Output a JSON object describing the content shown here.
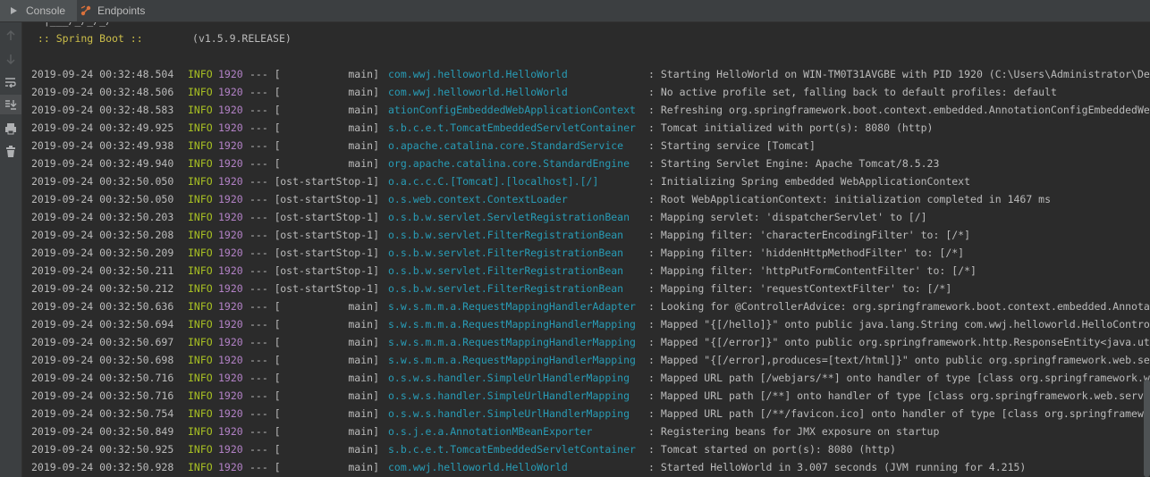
{
  "tabs": [
    {
      "label": "Console",
      "icon": "console-icon",
      "active": true
    },
    {
      "label": "Endpoints",
      "icon": "endpoints-icon",
      "active": false
    }
  ],
  "toolbar": [
    {
      "icon": "arrow-up-icon"
    },
    {
      "icon": "arrow-down-icon"
    },
    {
      "icon": "soft-wrap-icon"
    },
    {
      "icon": "scroll-to-end-icon"
    },
    {
      "icon": "print-icon"
    },
    {
      "icon": "trash-icon"
    }
  ],
  "banner": {
    "art_tail": "  |___/_/_/_/",
    "spring_label": " :: Spring Boot :: ",
    "version": "       (v1.5.9.RELEASE)"
  },
  "colors": {
    "background": "#2b2b2b",
    "info": "#a8c023",
    "pid": "#b382c7",
    "logger": "#289cb6",
    "text": "#bbbbbb"
  },
  "log_rows": [
    {
      "time": "2019-09-24 00:32:48.504",
      "level": "INFO",
      "pid": "1920",
      "sep": "--- [",
      "thread": "main]",
      "logger": "com.wwj.helloworld.HelloWorld",
      "message": ": Starting HelloWorld on WIN-TM0T31AVGBE with PID 1920 (C:\\Users\\Administrator\\De"
    },
    {
      "time": "2019-09-24 00:32:48.506",
      "level": "INFO",
      "pid": "1920",
      "sep": "--- [",
      "thread": "main]",
      "logger": "com.wwj.helloworld.HelloWorld",
      "message": ": No active profile set, falling back to default profiles: default"
    },
    {
      "time": "2019-09-24 00:32:48.583",
      "level": "INFO",
      "pid": "1920",
      "sep": "--- [",
      "thread": "main]",
      "logger": "ationConfigEmbeddedWebApplicationContext",
      "message": ": Refreshing org.springframework.boot.context.embedded.AnnotationConfigEmbeddedWe"
    },
    {
      "time": "2019-09-24 00:32:49.925",
      "level": "INFO",
      "pid": "1920",
      "sep": "--- [",
      "thread": "main]",
      "logger": "s.b.c.e.t.TomcatEmbeddedServletContainer",
      "message": ": Tomcat initialized with port(s): 8080 (http)"
    },
    {
      "time": "2019-09-24 00:32:49.938",
      "level": "INFO",
      "pid": "1920",
      "sep": "--- [",
      "thread": "main]",
      "logger": "o.apache.catalina.core.StandardService",
      "message": ": Starting service [Tomcat]"
    },
    {
      "time": "2019-09-24 00:32:49.940",
      "level": "INFO",
      "pid": "1920",
      "sep": "--- [",
      "thread": "main]",
      "logger": "org.apache.catalina.core.StandardEngine",
      "message": ": Starting Servlet Engine: Apache Tomcat/8.5.23"
    },
    {
      "time": "2019-09-24 00:32:50.050",
      "level": "INFO",
      "pid": "1920",
      "sep": "--- [",
      "thread": "ost-startStop-1]",
      "logger": "o.a.c.c.C.[Tomcat].[localhost].[/]",
      "message": ": Initializing Spring embedded WebApplicationContext"
    },
    {
      "time": "2019-09-24 00:32:50.050",
      "level": "INFO",
      "pid": "1920",
      "sep": "--- [",
      "thread": "ost-startStop-1]",
      "logger": "o.s.web.context.ContextLoader",
      "message": ": Root WebApplicationContext: initialization completed in 1467 ms"
    },
    {
      "time": "2019-09-24 00:32:50.203",
      "level": "INFO",
      "pid": "1920",
      "sep": "--- [",
      "thread": "ost-startStop-1]",
      "logger": "o.s.b.w.servlet.ServletRegistrationBean",
      "message": ": Mapping servlet: 'dispatcherServlet' to [/]"
    },
    {
      "time": "2019-09-24 00:32:50.208",
      "level": "INFO",
      "pid": "1920",
      "sep": "--- [",
      "thread": "ost-startStop-1]",
      "logger": "o.s.b.w.servlet.FilterRegistrationBean",
      "message": ": Mapping filter: 'characterEncodingFilter' to: [/*]"
    },
    {
      "time": "2019-09-24 00:32:50.209",
      "level": "INFO",
      "pid": "1920",
      "sep": "--- [",
      "thread": "ost-startStop-1]",
      "logger": "o.s.b.w.servlet.FilterRegistrationBean",
      "message": ": Mapping filter: 'hiddenHttpMethodFilter' to: [/*]"
    },
    {
      "time": "2019-09-24 00:32:50.211",
      "level": "INFO",
      "pid": "1920",
      "sep": "--- [",
      "thread": "ost-startStop-1]",
      "logger": "o.s.b.w.servlet.FilterRegistrationBean",
      "message": ": Mapping filter: 'httpPutFormContentFilter' to: [/*]"
    },
    {
      "time": "2019-09-24 00:32:50.212",
      "level": "INFO",
      "pid": "1920",
      "sep": "--- [",
      "thread": "ost-startStop-1]",
      "logger": "o.s.b.w.servlet.FilterRegistrationBean",
      "message": ": Mapping filter: 'requestContextFilter' to: [/*]"
    },
    {
      "time": "2019-09-24 00:32:50.636",
      "level": "INFO",
      "pid": "1920",
      "sep": "--- [",
      "thread": "main]",
      "logger": "s.w.s.m.m.a.RequestMappingHandlerAdapter",
      "message": ": Looking for @ControllerAdvice: org.springframework.boot.context.embedded.Annota"
    },
    {
      "time": "2019-09-24 00:32:50.694",
      "level": "INFO",
      "pid": "1920",
      "sep": "--- [",
      "thread": "main]",
      "logger": "s.w.s.m.m.a.RequestMappingHandlerMapping",
      "message": ": Mapped \"{[/hello]}\" onto public java.lang.String com.wwj.helloworld.HelloContro"
    },
    {
      "time": "2019-09-24 00:32:50.697",
      "level": "INFO",
      "pid": "1920",
      "sep": "--- [",
      "thread": "main]",
      "logger": "s.w.s.m.m.a.RequestMappingHandlerMapping",
      "message": ": Mapped \"{[/error]}\" onto public org.springframework.http.ResponseEntity<java.ut"
    },
    {
      "time": "2019-09-24 00:32:50.698",
      "level": "INFO",
      "pid": "1920",
      "sep": "--- [",
      "thread": "main]",
      "logger": "s.w.s.m.m.a.RequestMappingHandlerMapping",
      "message": ": Mapped \"{[/error],produces=[text/html]}\" onto public org.springframework.web.se"
    },
    {
      "time": "2019-09-24 00:32:50.716",
      "level": "INFO",
      "pid": "1920",
      "sep": "--- [",
      "thread": "main]",
      "logger": "o.s.w.s.handler.SimpleUrlHandlerMapping",
      "message": ": Mapped URL path [/webjars/**] onto handler of type [class org.springframework.w"
    },
    {
      "time": "2019-09-24 00:32:50.716",
      "level": "INFO",
      "pid": "1920",
      "sep": "--- [",
      "thread": "main]",
      "logger": "o.s.w.s.handler.SimpleUrlHandlerMapping",
      "message": ": Mapped URL path [/**] onto handler of type [class org.springframework.web.servl"
    },
    {
      "time": "2019-09-24 00:32:50.754",
      "level": "INFO",
      "pid": "1920",
      "sep": "--- [",
      "thread": "main]",
      "logger": "o.s.w.s.handler.SimpleUrlHandlerMapping",
      "message": ": Mapped URL path [/**/favicon.ico] onto handler of type [class org.springframewo"
    },
    {
      "time": "2019-09-24 00:32:50.849",
      "level": "INFO",
      "pid": "1920",
      "sep": "--- [",
      "thread": "main]",
      "logger": "o.s.j.e.a.AnnotationMBeanExporter",
      "message": ": Registering beans for JMX exposure on startup"
    },
    {
      "time": "2019-09-24 00:32:50.925",
      "level": "INFO",
      "pid": "1920",
      "sep": "--- [",
      "thread": "main]",
      "logger": "s.b.c.e.t.TomcatEmbeddedServletContainer",
      "message": ": Tomcat started on port(s): 8080 (http)"
    },
    {
      "time": "2019-09-24 00:32:50.928",
      "level": "INFO",
      "pid": "1920",
      "sep": "--- [",
      "thread": "main]",
      "logger": "com.wwj.helloworld.HelloWorld",
      "message": ": Started HelloWorld in 3.007 seconds (JVM running for 4.215)"
    }
  ]
}
